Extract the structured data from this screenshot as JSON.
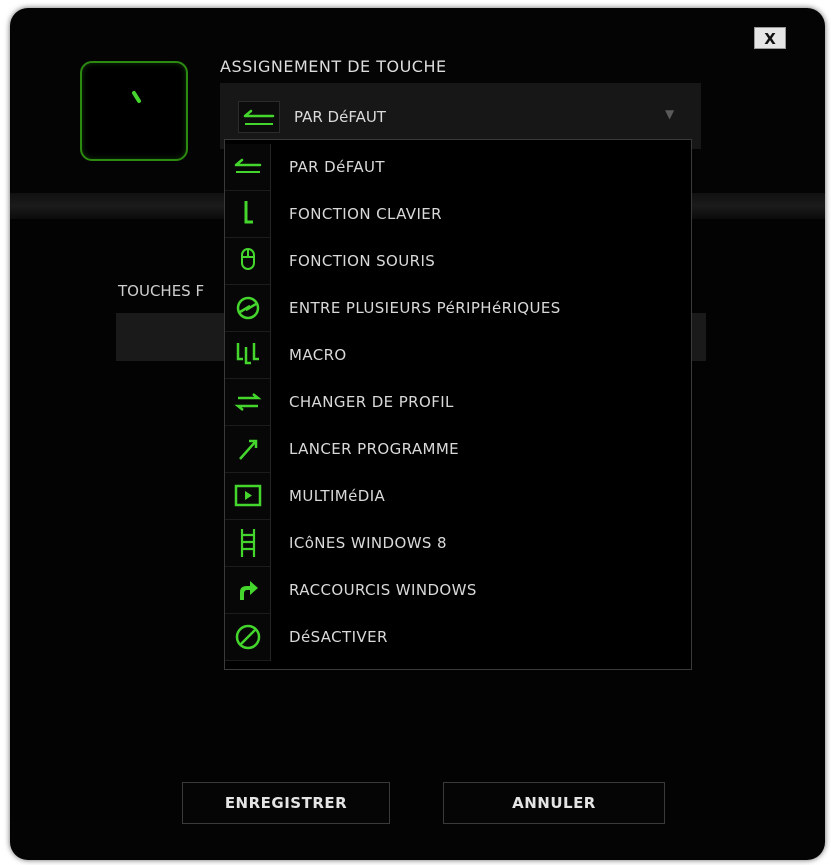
{
  "dialog": {
    "close_label": "X",
    "title": "ASSIGNEMENT DE TOUCHE",
    "selected": {
      "label": "PAR DéFAUT",
      "icon": "default-arrow-icon"
    },
    "section_label": "TOUCHES F"
  },
  "menu": {
    "items": [
      {
        "label": "PAR DéFAUT",
        "icon": "default-arrow-icon"
      },
      {
        "label": "FONCTION CLAVIER",
        "icon": "keyboard-function-icon"
      },
      {
        "label": "FONCTION SOURIS",
        "icon": "mouse-icon"
      },
      {
        "label": "ENTRE PLUSIEURS PéRIPHéRIQUES",
        "icon": "inter-device-icon"
      },
      {
        "label": "MACRO",
        "icon": "macro-icon"
      },
      {
        "label": "CHANGER DE PROFIL",
        "icon": "switch-profile-icon"
      },
      {
        "label": "LANCER PROGRAMME",
        "icon": "launch-program-icon"
      },
      {
        "label": "MULTIMéDIA",
        "icon": "multimedia-play-icon"
      },
      {
        "label": "ICôNES WINDOWS 8",
        "icon": "windows8-charms-icon"
      },
      {
        "label": "RACCOURCIS WINDOWS",
        "icon": "windows-shortcut-icon"
      },
      {
        "label": "DéSACTIVER",
        "icon": "disable-icon"
      }
    ]
  },
  "buttons": {
    "save": "ENREGISTRER",
    "cancel": "ANNULER"
  },
  "colors": {
    "accent": "#44d62c",
    "background": "#040404",
    "panel": "#171717"
  }
}
